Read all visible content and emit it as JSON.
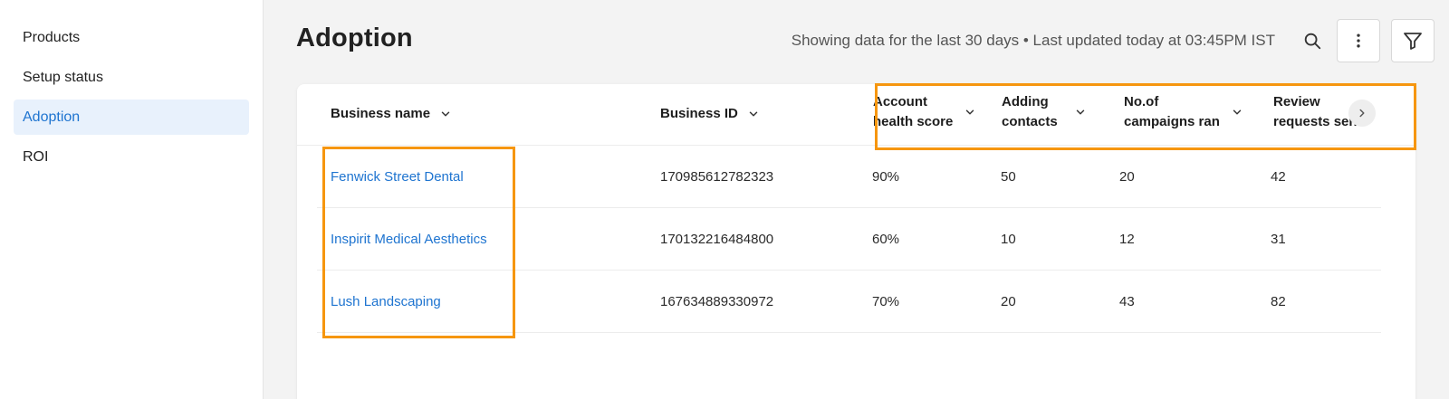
{
  "sidebar": {
    "items": [
      {
        "label": "Products"
      },
      {
        "label": "Setup status"
      },
      {
        "label": "Adoption"
      },
      {
        "label": "ROI"
      }
    ]
  },
  "header": {
    "title": "Adoption",
    "status": "Showing data for the last 30 days • Last updated today at 03:45PM IST"
  },
  "table": {
    "columns": [
      {
        "label": "Business name"
      },
      {
        "label": "Business ID"
      },
      {
        "label": "Account health score"
      },
      {
        "label": "Adding contacts"
      },
      {
        "label": "No.of campaigns ran"
      },
      {
        "label": "Review requests sent"
      }
    ],
    "rows": [
      {
        "name": "Fenwick Street Dental",
        "id": "170985612782323",
        "health": "90%",
        "contacts": "50",
        "campaigns": "20",
        "reviews": "42"
      },
      {
        "name": "Inspirit Medical Aesthetics",
        "id": "170132216484800",
        "health": "60%",
        "contacts": "10",
        "campaigns": "12",
        "reviews": "31"
      },
      {
        "name": "Lush Landscaping",
        "id": "167634889330972",
        "health": "70%",
        "contacts": "20",
        "campaigns": "43",
        "reviews": "82"
      }
    ]
  },
  "colors": {
    "accent": "#1e74d0",
    "highlight": "#f6960f",
    "active_bg": "#e8f1fc"
  },
  "icons": [
    "search-icon",
    "more-vertical-icon",
    "filter-icon",
    "chevron-down-icon",
    "chevron-right-icon"
  ]
}
